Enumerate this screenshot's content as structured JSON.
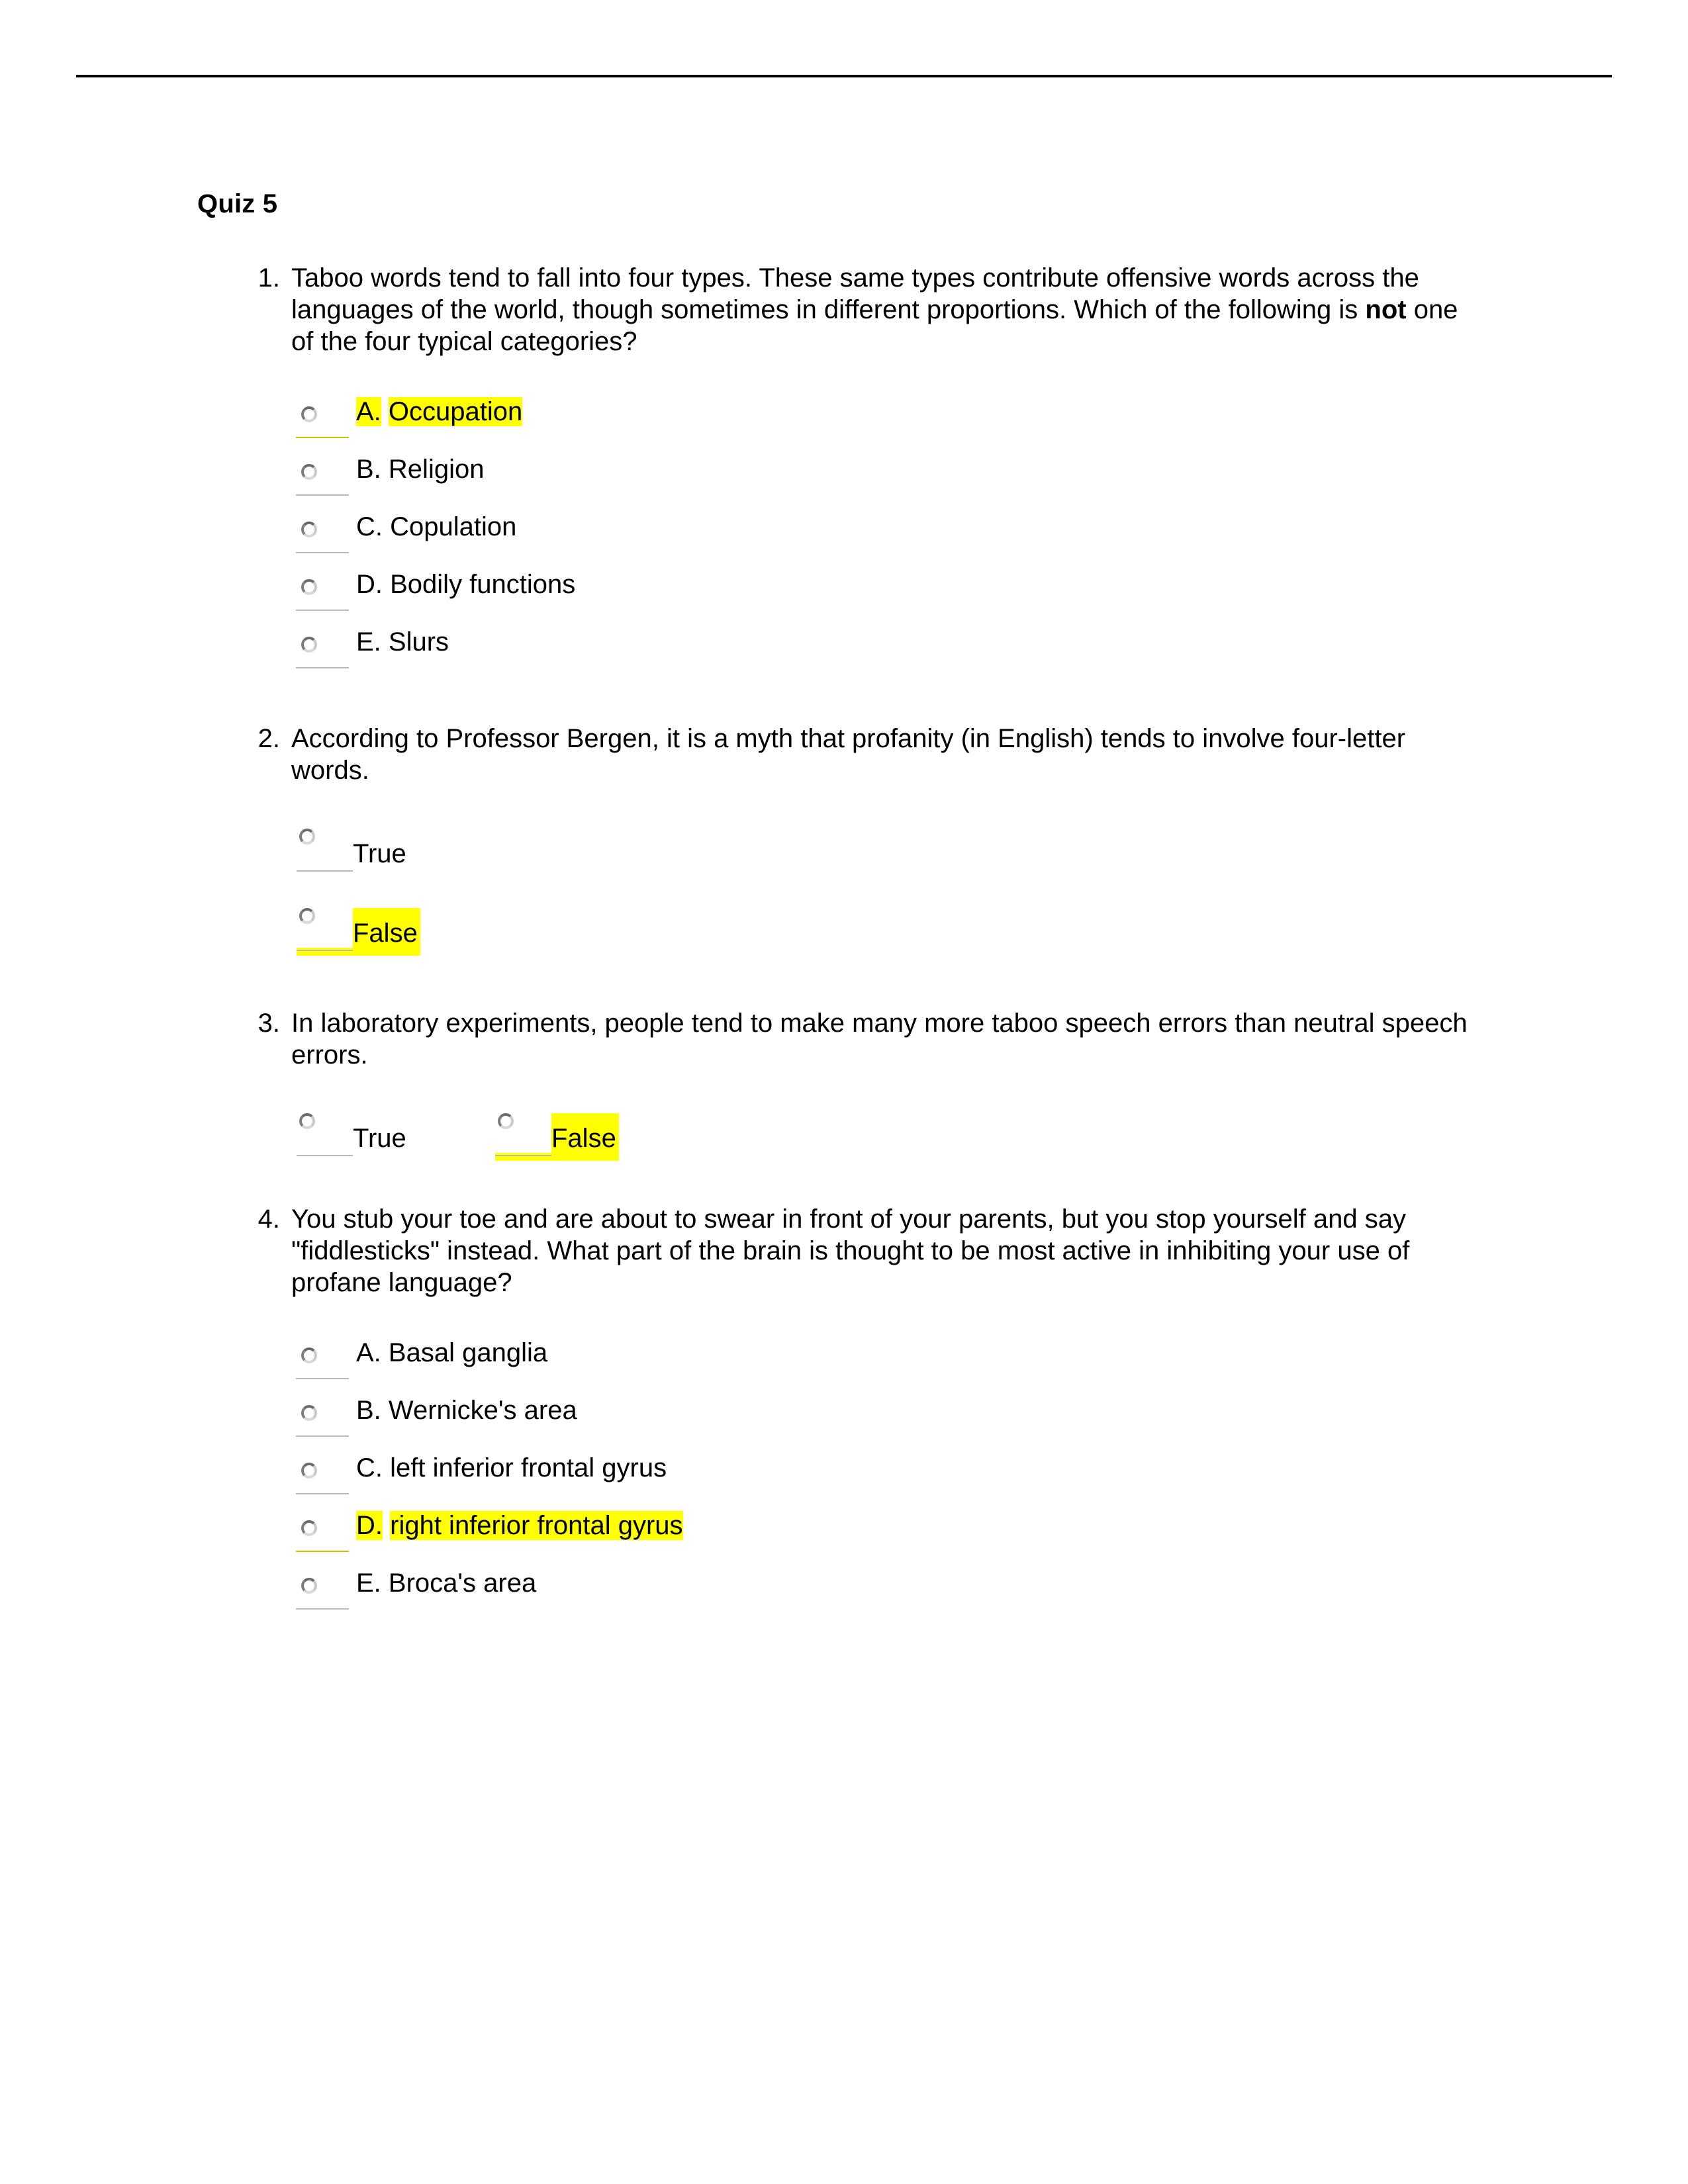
{
  "document": {
    "title": "Quiz 5",
    "highlight_color": "#ffff00",
    "text_color": "#000000",
    "page_background": "#ffffff"
  },
  "questions": [
    {
      "number": "1.",
      "type": "multiple-choice",
      "text_parts": {
        "before": "Taboo words tend to fall into four types. These same types contribute offensive words across the languages of the world, though sometimes in different proportions. Which of the following is ",
        "emphasis": "not",
        "after": " one of the four typical categories?"
      },
      "options": [
        {
          "letter": "A.",
          "label": "Occupation",
          "highlighted": true,
          "selected": false
        },
        {
          "letter": "B.",
          "label": "Religion",
          "highlighted": false,
          "selected": false
        },
        {
          "letter": "C.",
          "label": "Copulation",
          "highlighted": false,
          "selected": false
        },
        {
          "letter": "D.",
          "label": "Bodily functions",
          "highlighted": false,
          "selected": false
        },
        {
          "letter": "E.",
          "label": "Slurs",
          "highlighted": false,
          "selected": false
        }
      ]
    },
    {
      "number": "2.",
      "type": "true-false-stacked",
      "text": "According to Professor Bergen, it is a myth that profanity (in English) tends to involve four-letter words.",
      "options": [
        {
          "label": "True",
          "highlighted": false,
          "selected": false
        },
        {
          "label": "False",
          "highlighted": true,
          "selected": false
        }
      ]
    },
    {
      "number": "3.",
      "type": "true-false-inline",
      "text": "In laboratory experiments, people tend to make many more taboo speech errors than neutral speech errors.",
      "options": [
        {
          "label": "True",
          "highlighted": false,
          "selected": false
        },
        {
          "label": "False",
          "highlighted": true,
          "selected": false
        }
      ]
    },
    {
      "number": "4.",
      "type": "multiple-choice",
      "text": "You stub your toe and are about to swear in front of your parents, but you stop yourself and say \"fiddlesticks\" instead. What part of the brain is thought to be most active in inhibiting your use of profane language?",
      "options": [
        {
          "letter": "A.",
          "label": "Basal ganglia",
          "highlighted": false,
          "selected": false
        },
        {
          "letter": "B.",
          "label": "Wernicke's area",
          "highlighted": false,
          "selected": false
        },
        {
          "letter": "C.",
          "label": "left inferior frontal gyrus",
          "highlighted": false,
          "selected": false
        },
        {
          "letter": "D.",
          "label": "right inferior frontal gyrus",
          "highlighted": true,
          "selected": false
        },
        {
          "letter": "E.",
          "label": "Broca's area",
          "highlighted": false,
          "selected": false
        }
      ]
    }
  ]
}
